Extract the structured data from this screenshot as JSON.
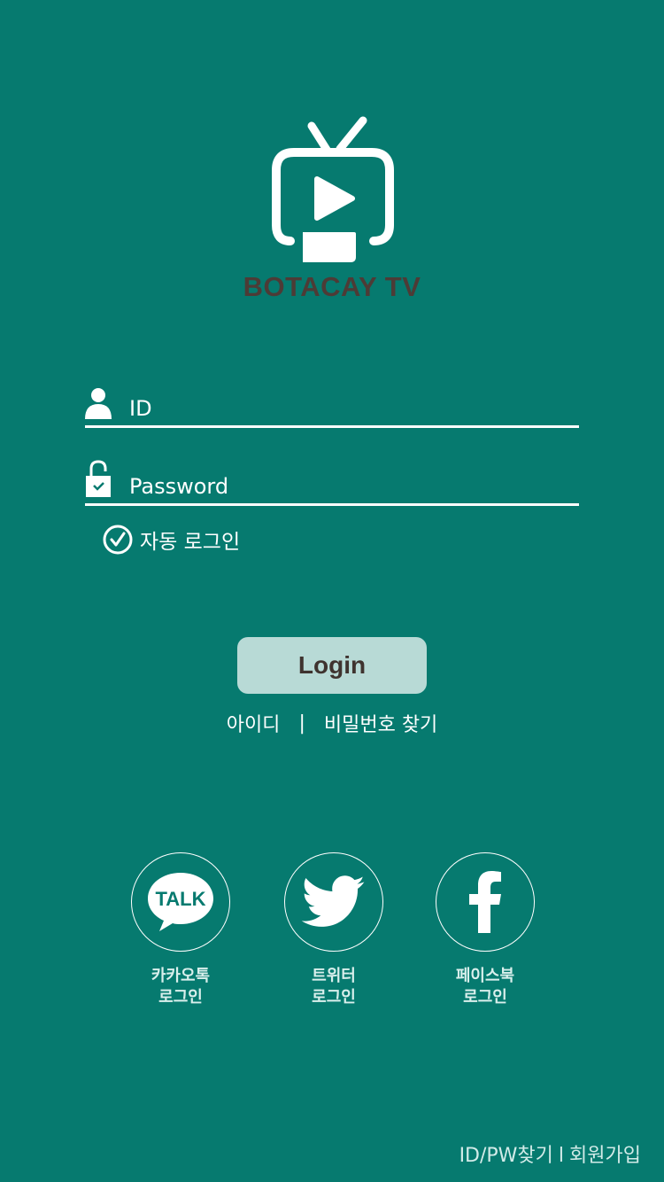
{
  "app": {
    "name": "BOTACAY TV"
  },
  "form": {
    "id_placeholder": "ID",
    "password_placeholder": "Password",
    "auto_login_label": "자동 로그인",
    "auto_login_checked": true,
    "login_button": "Login"
  },
  "find_links": {
    "find_id": "아이디",
    "separator": "|",
    "find_password": "비밀번호 찾기"
  },
  "social": [
    {
      "label_line1": "카카오톡",
      "label_line2": "로그인",
      "icon": "kakao-talk-icon",
      "icon_text": "TALK"
    },
    {
      "label_line1": "트위터",
      "label_line2": "로그인",
      "icon": "twitter-icon"
    },
    {
      "label_line1": "페이스북",
      "label_line2": "로그인",
      "icon": "facebook-icon"
    }
  ],
  "bottom": {
    "find_id_pw": "ID/PW찾기",
    "separator": "l",
    "sign_up": "회원가입"
  },
  "colors": {
    "background": "#067a6f",
    "button": "#b8dad6",
    "app_name": "#4d3b36"
  }
}
